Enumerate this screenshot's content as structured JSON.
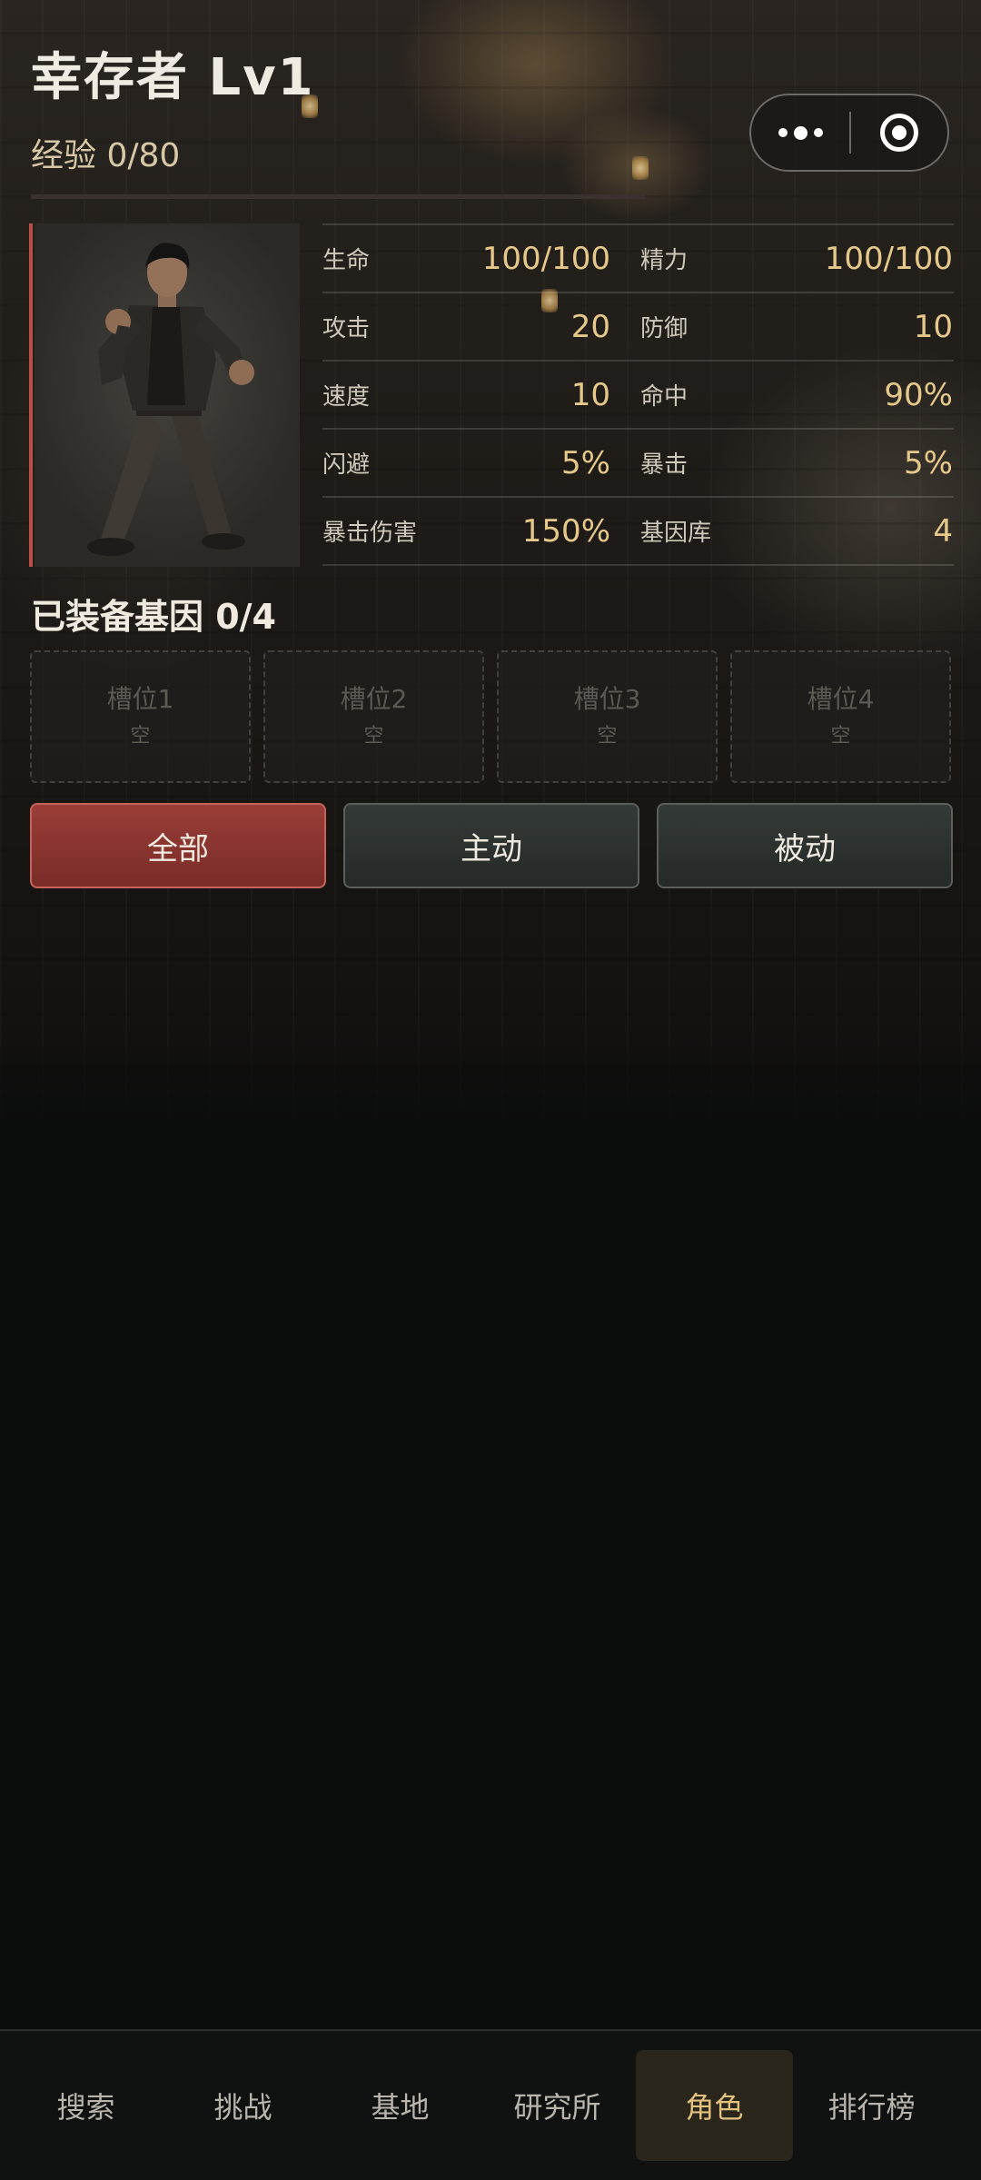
{
  "header": {
    "title": "幸存者 Lv1",
    "exp_label": "经验 0/80",
    "exp_progress": 0
  },
  "capsule": {
    "more_icon": "more-dots-icon",
    "close_icon": "record-ring-icon"
  },
  "stats": [
    [
      {
        "label": "生命",
        "value": "100/100"
      },
      {
        "label": "精力",
        "value": "100/100"
      }
    ],
    [
      {
        "label": "攻击",
        "value": "20"
      },
      {
        "label": "防御",
        "value": "10"
      }
    ],
    [
      {
        "label": "速度",
        "value": "10"
      },
      {
        "label": "命中",
        "value": "90%"
      }
    ],
    [
      {
        "label": "闪避",
        "value": "5%"
      },
      {
        "label": "暴击",
        "value": "5%"
      }
    ],
    [
      {
        "label": "暴击伤害",
        "value": "150%"
      },
      {
        "label": "基因库",
        "value": "4"
      }
    ]
  ],
  "genes": {
    "title": "已装备基因 0/4",
    "slots": [
      {
        "name": "槽位1",
        "state": "空"
      },
      {
        "name": "槽位2",
        "state": "空"
      },
      {
        "name": "槽位3",
        "state": "空"
      },
      {
        "name": "槽位4",
        "state": "空"
      }
    ]
  },
  "filters": [
    {
      "label": "全部",
      "active": true
    },
    {
      "label": "主动",
      "active": false
    },
    {
      "label": "被动",
      "active": false
    }
  ],
  "nav": [
    {
      "label": "搜索",
      "active": false
    },
    {
      "label": "挑战",
      "active": false
    },
    {
      "label": "基地",
      "active": false
    },
    {
      "label": "研究所",
      "active": false
    },
    {
      "label": "角色",
      "active": true
    },
    {
      "label": "排行榜",
      "active": false
    }
  ],
  "colors": {
    "accent_red": "#b84f48",
    "value_gold": "#e6c98a",
    "nav_active": "#e2c27e"
  }
}
